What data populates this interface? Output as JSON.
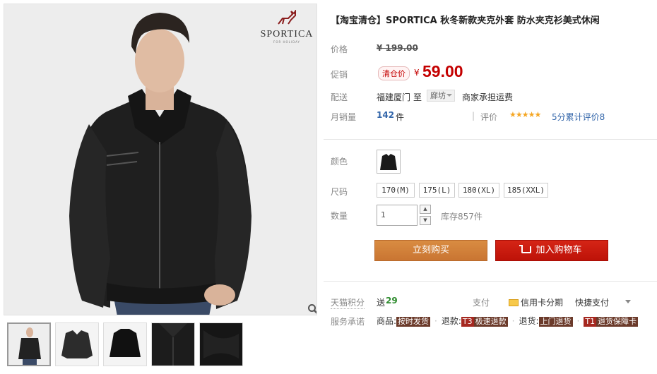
{
  "product": {
    "title": "【淘宝清仓】SPORTICA 秋冬新款夹克外套 防水夹克衫美式休闲",
    "brand": "SPORTICA",
    "brand_sub": "FOR HOLIDAY"
  },
  "price": {
    "label": "价格",
    "original": "¥ 199.00"
  },
  "promo": {
    "label": "促销",
    "tag": "清仓价",
    "currency": "¥",
    "value": "59.00"
  },
  "shipping": {
    "label": "配送",
    "from": "福建厦门",
    "to_word": "至",
    "destination": "廊坊",
    "note": "商家承担运费"
  },
  "sales": {
    "label": "月销量",
    "count": "142",
    "unit": "件",
    "rating_label": "评价",
    "stars": "★★★★★",
    "rating_text": "5分累计评价8"
  },
  "color": {
    "label": "颜色"
  },
  "size": {
    "label": "尺码",
    "options": [
      "170(M)",
      "175(L)",
      "180(XL)",
      "185(XXL)"
    ]
  },
  "quantity": {
    "label": "数量",
    "value": "1",
    "up": "▲",
    "down": "▼",
    "stock": "库存857件"
  },
  "buttons": {
    "buy_now": "立刻购买",
    "add_to_cart": "加入购物车"
  },
  "points": {
    "label": "天猫积分",
    "prefix": "送",
    "value": "29"
  },
  "payment": {
    "label": "支付",
    "credit": "信用卡分期",
    "quick": "快捷支付"
  },
  "service": {
    "label": "服务承诺",
    "goods_label": "商品:",
    "goods_tag": "按时发货",
    "refund_label": "退款:",
    "refund_code": "T3",
    "refund_tag": "极速退款",
    "return_label": "退货:",
    "return_tag": "上门退货",
    "return_code": "T1",
    "return_tag2": "退货保障卡"
  },
  "colors": {
    "price_red": "#c40000",
    "buy_orange": "#cf7f38",
    "cart_red": "#c8180c",
    "points_green": "#2e8b2e",
    "sales_blue": "#3366aa"
  },
  "icons": [
    "search-icon",
    "cart-icon",
    "credit-card-icon",
    "chevron-down-icon",
    "deer-logo-icon"
  ]
}
